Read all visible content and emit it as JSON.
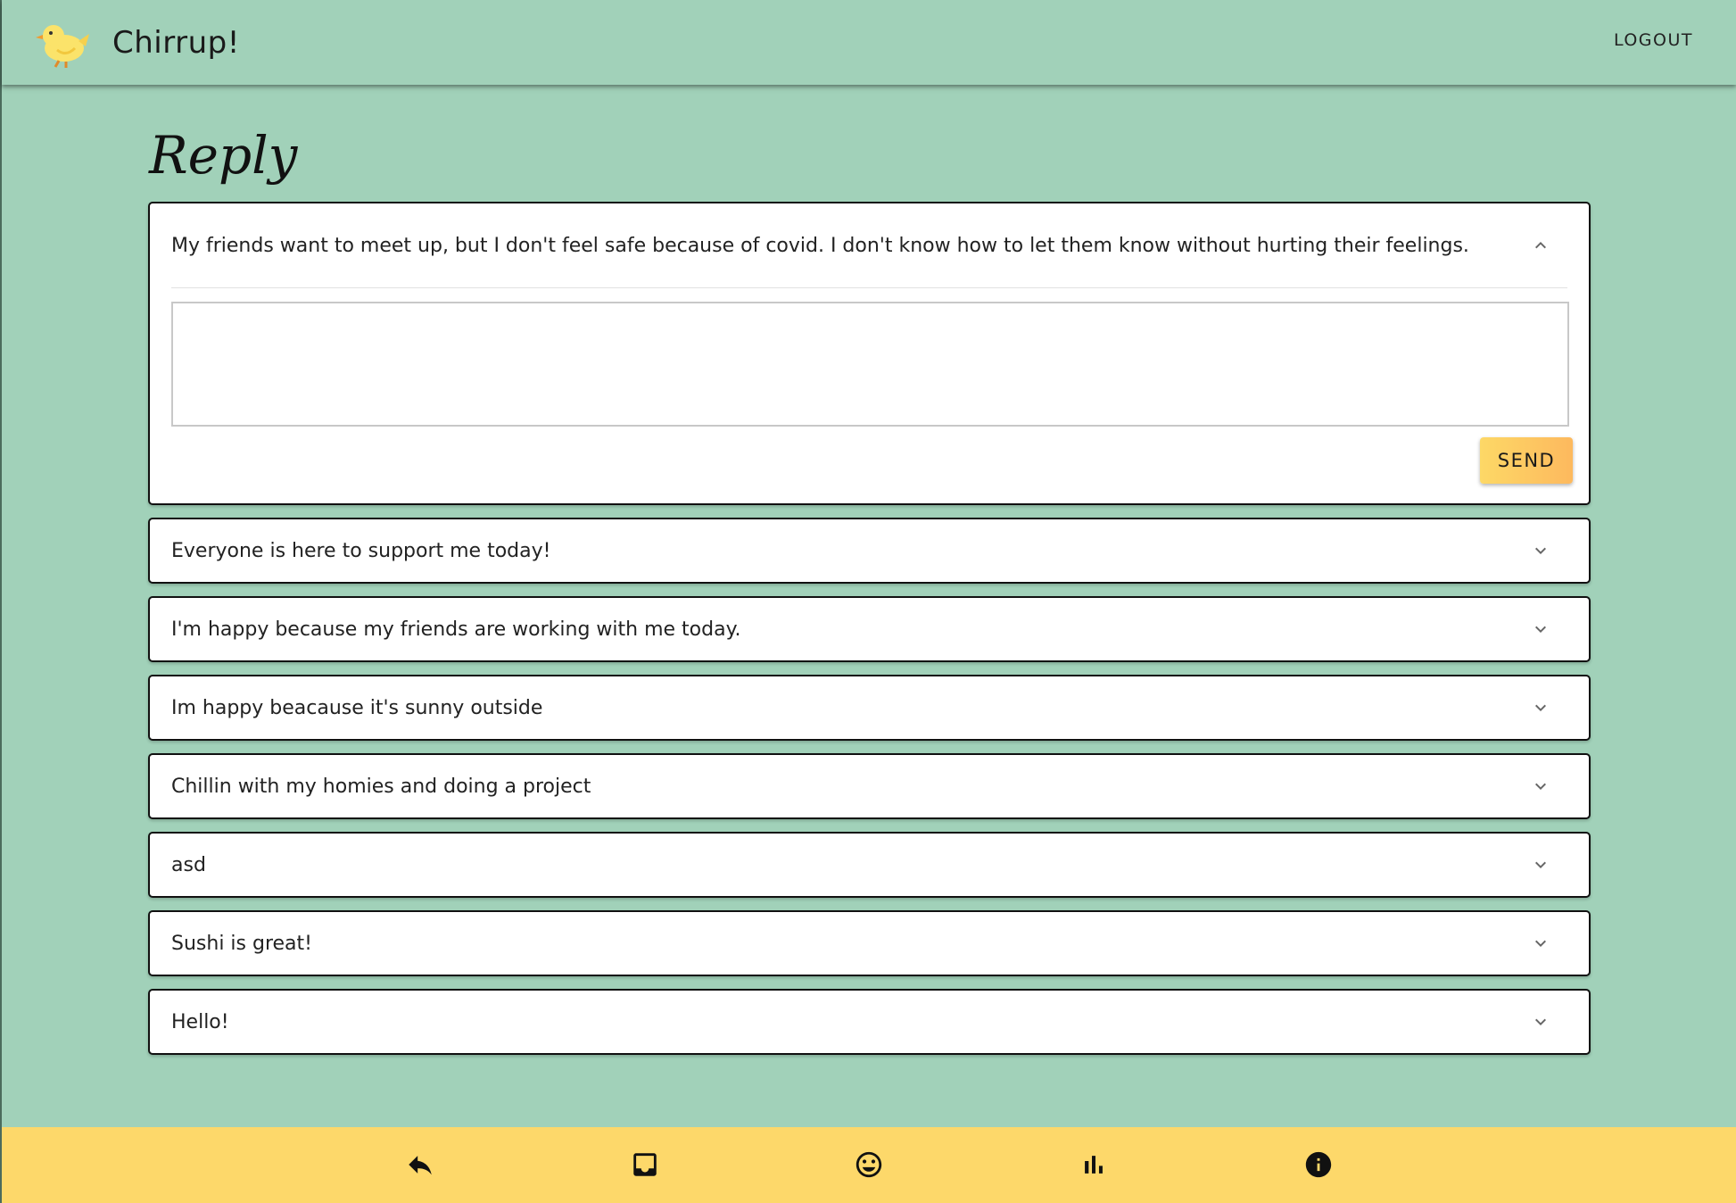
{
  "header": {
    "title": "Chirrup!",
    "logout_label": "LOGOUT",
    "logo_icon": "baby-chick-icon"
  },
  "main": {
    "heading": "Reply",
    "expanded_post": {
      "text": "My friends want to meet up, but I don't feel safe because of covid. I don't know how to let them know without hurting their feelings.",
      "reply_value": "",
      "send_label": "SEND"
    },
    "posts": [
      "Everyone is here to support me today!",
      "I'm happy because my friends are working with me today.",
      "Im happy beacause it's sunny outside",
      "Chillin with my homies and doing a project",
      "asd",
      "Sushi is great!",
      "Hello!"
    ]
  },
  "bottom_nav": {
    "items": [
      "reply-icon",
      "inbox-icon",
      "mood-icon",
      "stats-icon",
      "info-icon"
    ]
  },
  "colors": {
    "background": "#a1d1b9",
    "bottom_bar": "#fdd86a",
    "send_gradient_start": "#fdd866",
    "send_gradient_end": "#fdb95e"
  }
}
